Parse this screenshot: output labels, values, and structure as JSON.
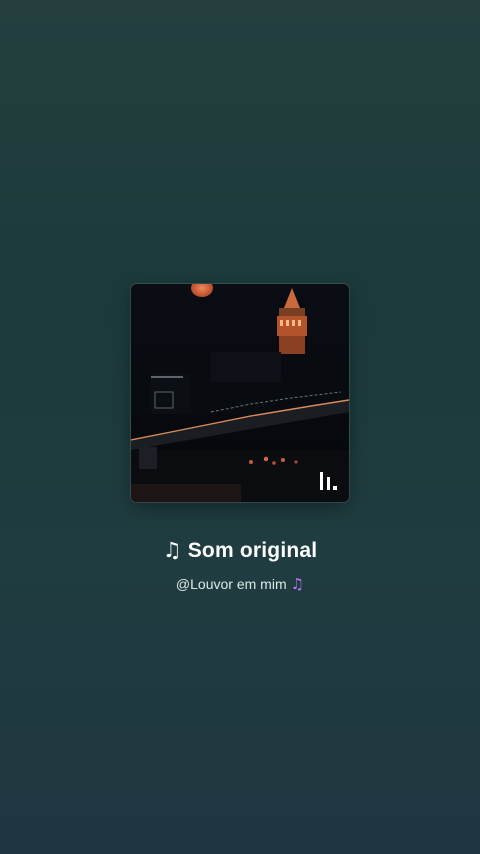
{
  "sound": {
    "title": "Som original",
    "title_icon": "music-note-icon",
    "author": "@Louvor em mim",
    "author_icon": "purple-music-note-icon",
    "author_icon_color": "#b978f0"
  },
  "cover": {
    "badge_icon": "music-bars-icon"
  }
}
